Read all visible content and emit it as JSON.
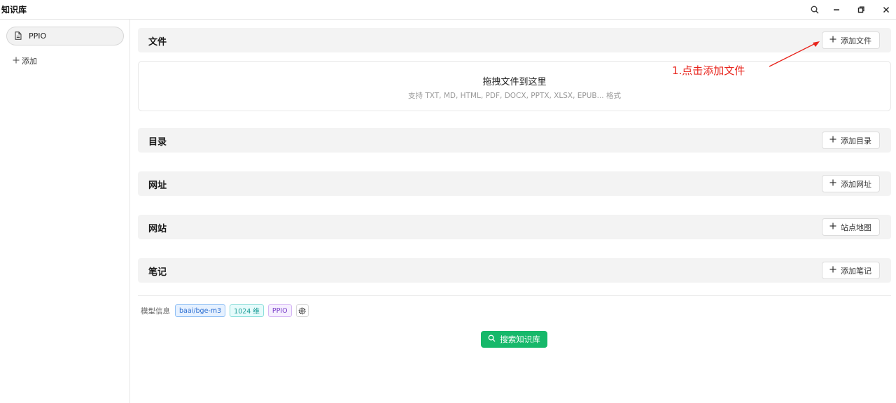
{
  "app": {
    "title": "知识库"
  },
  "window_controls": [
    "search-icon",
    "minimize-icon",
    "restore-icon",
    "close-icon"
  ],
  "sidebar": {
    "items": [
      {
        "label": "PPIO",
        "icon": "document-icon",
        "selected": true
      }
    ],
    "add_label": "添加"
  },
  "sections": {
    "files": {
      "title": "文件",
      "button": "添加文件"
    },
    "directory": {
      "title": "目录",
      "button": "添加目录"
    },
    "url": {
      "title": "网址",
      "button": "添加网址"
    },
    "website": {
      "title": "网站",
      "button": "站点地图"
    },
    "notes": {
      "title": "笔记",
      "button": "添加笔记"
    }
  },
  "dropzone": {
    "title": "拖拽文件到这里",
    "subtitle": "支持 TXT, MD, HTML, PDF, DOCX, PPTX, XLSX, EPUB... 格式"
  },
  "annotation": {
    "text": "1.点击添加文件",
    "color": "#e8241c"
  },
  "model_info": {
    "label": "模型信息",
    "tags": [
      "baai/bge-m3",
      "1024 维",
      "PPIO"
    ]
  },
  "search_button": {
    "label": "搜索知识库",
    "color": "#16b86a"
  }
}
